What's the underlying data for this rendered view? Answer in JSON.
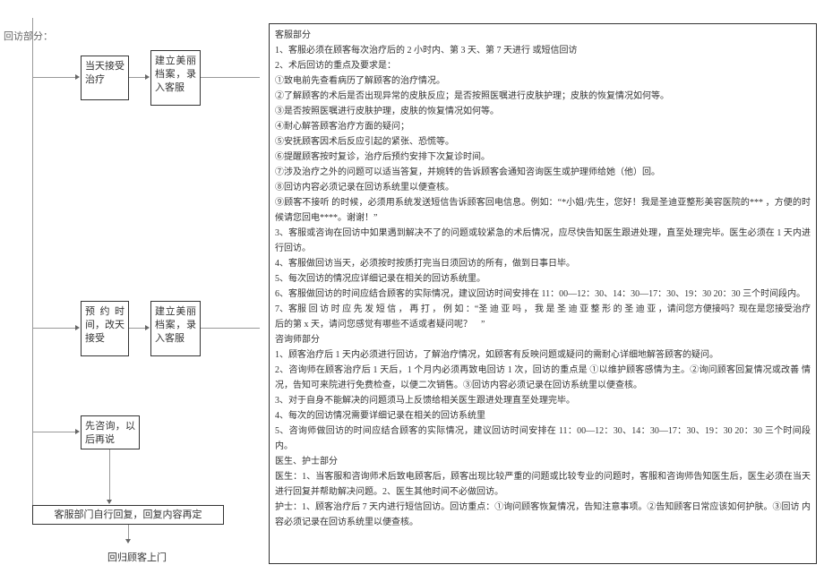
{
  "section_label": "回访部分：",
  "flow": {
    "box_a1": "当天接受治疗",
    "box_a2": "建立美丽　档案，录入客服",
    "box_b1": "预约时间，改天接受",
    "box_b2": "建立美丽　档案，录入客服",
    "box_c1": "先咨询，以后再说",
    "box_bottom": "客服部门自行回复，回复内容再定",
    "bottom_label": "回归顾客上门"
  },
  "panel": {
    "h1": "客服部分",
    "p1": "1、客服必须在顾客每次治疗后的 2 小时内、第 3 天、第 7 天进行 或短信回访",
    "p2": "2、术后回访的重点及要求是：",
    "p2a": "①致电前先查看病历了解顾客的治疗情况。",
    "p2b": "②了解顾客的术后是否出现异常的皮肤反应；是否按照医嘱进行皮肤护理；皮肤的恢复情况如何等。",
    "p2c": "③是否按照医嘱进行皮肤护理，皮肤的恢复情况如何等。",
    "p2d": "④耐心解答顾客治疗方面的疑问；",
    "p2e": "⑤安抚顾客因术后反应引起的紧张、恐慌等。",
    "p2f": "⑥提醒顾客按时复诊，治疗后预约安排下次复诊时间。",
    "p2g": "⑦涉及治疗之外的问题可以适当答复，并婉转的告诉顾客会通知咨询医生或护理师给她（他）回。",
    "p2h": "⑧回访内容必须记录在回访系统里以便查核。",
    "p2i": "⑨顾客不接听 的时候，必须用系统发送短信告诉顾客回电信息。例如：“*小姐/先生，您好！我是圣迪亚整形美容医院的*** ，方便的时候请您回电****。谢谢！”",
    "p3": "3、客服或咨询在回访中如果遇到解决不了的问题或较紧急的术后情况，应尽快告知医生跟进处理，直至处理完毕。医生必须在 1 天内进行回访。",
    "p4": "4、客服做回访当天，必须按时按质打完当日须回访的所有，做到日事日毕。",
    "p5": "5、每次回访的情况应详细记录在相关的回访系统里。",
    "p6": "6、客服做回访的时间应结合顾客的实际情况，建议回访时间安排在 11：00—12：30、14：30—17：30、19：30 20：30 三个时间段内。",
    "p7": "7、客服 回 访 时 应 先 发 短 信 ， 再 打 ， 例 如 ：“圣 迪 亚 吗 ， 我 是 圣 迪 亚 整 形 的 圣 迪 亚 ，请问您方便接吗？现在是您接受治疗后的第 x 天，请问您感觉有哪些不适或者疑问呢？　”",
    "h2": "咨询师部分",
    "c1": "1、顾客治疗后 1 天内必须进行回访，了解治疗情况，如顾客有反映问题或疑问的需耐心详细地解答顾客的疑问。",
    "c2": "2、咨询师在顾客治疗后 1 天后，1 个月内必须再致电回访 1 次，回访的重点是 ①以维护顾客感情为主。②询问顾客回复情况或改善 情况，告知可来院进行免费检查，以便二次销售。③回访内容必须记录在回访系统里以便查核。",
    "c3": "3、对于自身不能解决的问题须马上反馈给相关医生跟进处理直至处理完毕。",
    "c4": "4、每次的回访情况需要详细记录在相关的回访系统里",
    "c5": "5、咨询师做回访的时间应结合顾客的实际情况，建议回访时间安排在 11：00—12：30、14：30—17：30、19：30 20：30 三个时间段内。",
    "h3": "医生、护士部分",
    "d1": "医生：1、当客服和咨询师术后致电顾客后，顾客出现比较严重的问题或比较专业的问题时，客服和咨询师告知医生后，医生必须在当天进行回复并帮助解决问题。2、医生其他时间不必做回访。",
    "n1": "护士：1、顾客治疗后 7 天内进行短信回访。回访重点：①询问顾客恢复情况，告知注意事项。②告知顾客日常应该如何护肤。③回访 内容必须记录在回访系统里以便查核。"
  }
}
